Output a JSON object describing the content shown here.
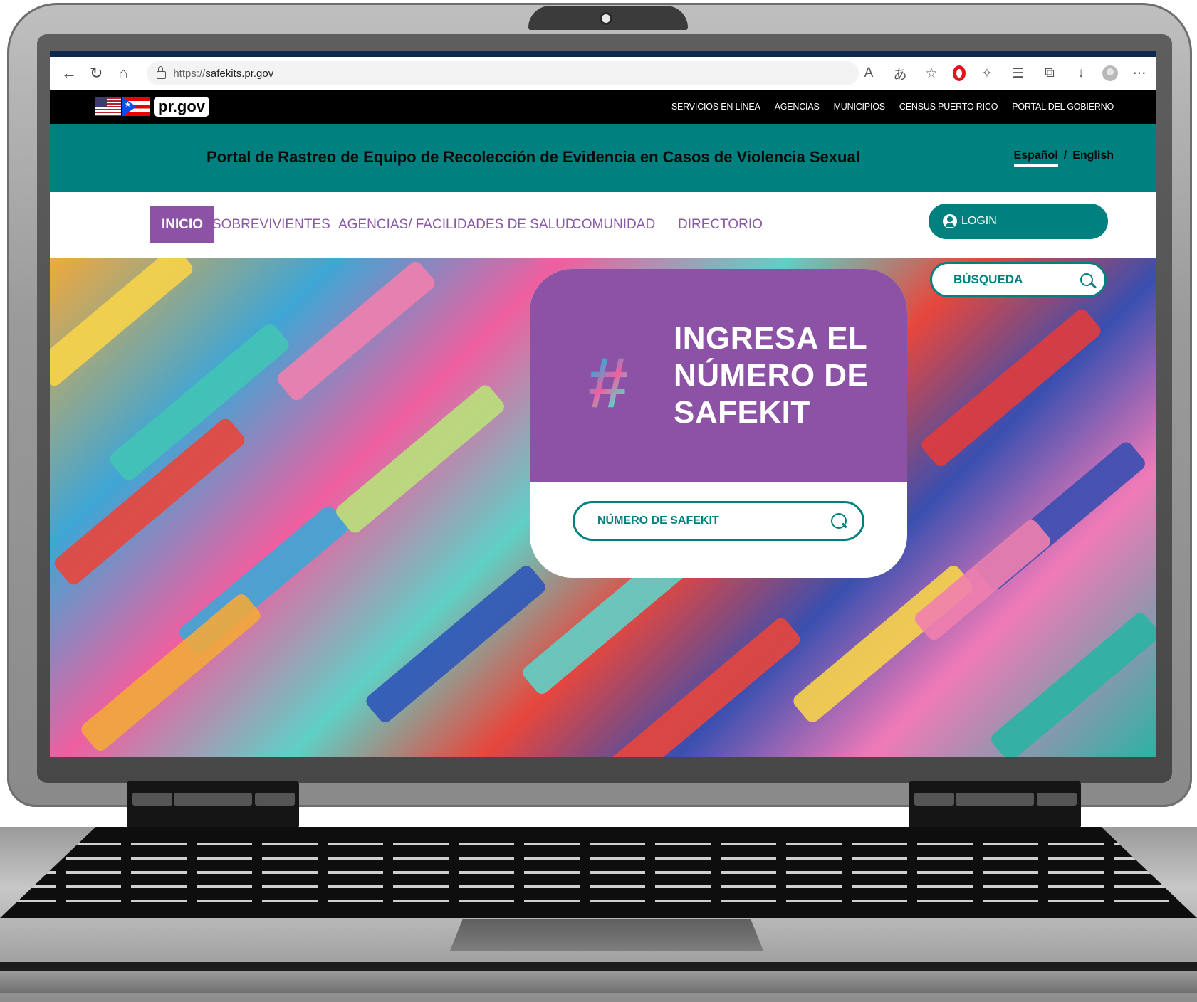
{
  "browser": {
    "url_scheme": "https://",
    "url_host": "safekits.pr.gov",
    "icons": [
      "back-icon",
      "refresh-icon",
      "home-icon",
      "read-aloud-icon",
      "translate-icon",
      "favorite-add-icon",
      "opera-icon",
      "extensions-icon",
      "favorites-icon",
      "collections-icon",
      "downloads-icon",
      "profile-icon",
      "more-icon"
    ]
  },
  "gov_bar": {
    "logo": "pr.gov",
    "links": [
      "SERVICIOS EN LÍNEA",
      "AGENCIAS",
      "MUNICIPIOS",
      "CENSUS PUERTO RICO",
      "PORTAL DEL GOBIERNO"
    ]
  },
  "header": {
    "title": "Portal de Rastreo de Equipo de Recolección de Evidencia en Casos de Violencia Sexual",
    "lang_es": "Español",
    "lang_sep": "/",
    "lang_en": "English"
  },
  "nav": {
    "items": [
      "INICIO",
      "SOBREVIVIENTES",
      "AGENCIAS/ FACILIDADES DE SALUD",
      "COMUNIDAD",
      "DIRECTORIO"
    ],
    "login_label": "LOGIN",
    "search_placeholder": "BÚSQUEDA"
  },
  "hero": {
    "heading_line1": "INGRESA EL",
    "heading_line2": "NÚMERO DE",
    "heading_line3": "SAFEKIT",
    "input_placeholder": "NÚMERO DE SAFEKIT"
  },
  "colors": {
    "teal": "#00807f",
    "purple": "#8c52a6",
    "black": "#000000"
  }
}
